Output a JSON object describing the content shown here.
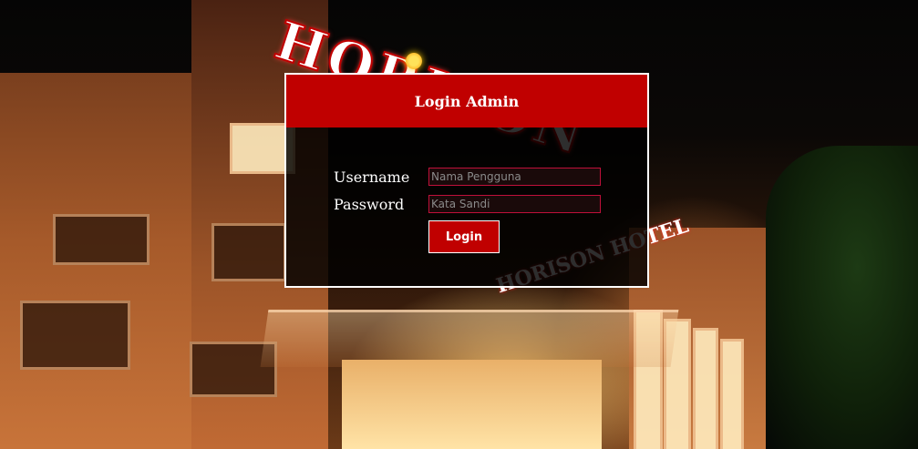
{
  "background": {
    "sign_main": "HORISON",
    "sign_small": "HORISON HOTEL"
  },
  "login": {
    "title": "Login Admin",
    "username_label": "Username",
    "username_placeholder": "Nama Pengguna",
    "password_label": "Password",
    "password_placeholder": "Kata Sandi",
    "submit_label": "Login"
  },
  "colors": {
    "header_red": "#c00000",
    "field_border": "#c0103a",
    "panel_border": "#ffffff"
  }
}
